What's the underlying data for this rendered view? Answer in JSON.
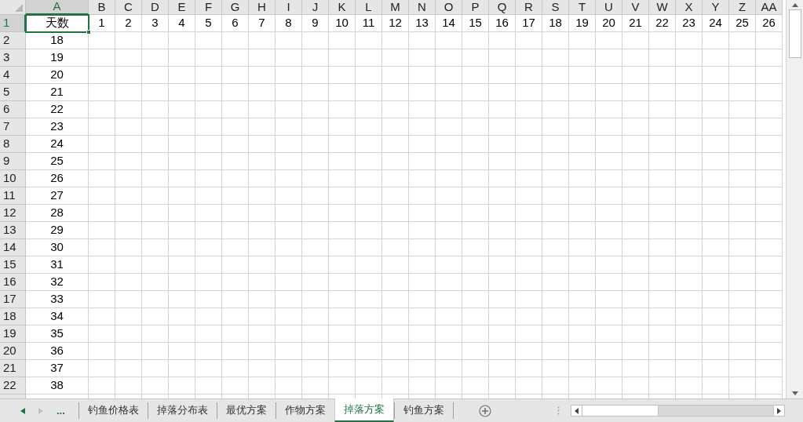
{
  "columns": [
    {
      "label": "A",
      "selected": true
    },
    {
      "label": "B",
      "selected": false
    },
    {
      "label": "C",
      "selected": false
    },
    {
      "label": "D",
      "selected": false
    },
    {
      "label": "E",
      "selected": false
    },
    {
      "label": "F",
      "selected": false
    },
    {
      "label": "G",
      "selected": false
    },
    {
      "label": "H",
      "selected": false
    },
    {
      "label": "I",
      "selected": false
    },
    {
      "label": "J",
      "selected": false
    },
    {
      "label": "K",
      "selected": false
    },
    {
      "label": "L",
      "selected": false
    },
    {
      "label": "M",
      "selected": false
    },
    {
      "label": "N",
      "selected": false
    },
    {
      "label": "O",
      "selected": false
    },
    {
      "label": "P",
      "selected": false
    },
    {
      "label": "Q",
      "selected": false
    },
    {
      "label": "R",
      "selected": false
    },
    {
      "label": "S",
      "selected": false
    },
    {
      "label": "T",
      "selected": false
    },
    {
      "label": "U",
      "selected": false
    },
    {
      "label": "V",
      "selected": false
    },
    {
      "label": "W",
      "selected": false
    },
    {
      "label": "X",
      "selected": false
    },
    {
      "label": "Y",
      "selected": false
    },
    {
      "label": "Z",
      "selected": false
    },
    {
      "label": "AA",
      "selected": false
    }
  ],
  "rows": [
    {
      "number": "1",
      "selected": true,
      "cells": [
        {
          "text": "天数",
          "selected": true
        },
        {
          "text": "1",
          "selected": false
        },
        {
          "text": "2",
          "selected": false
        },
        {
          "text": "3",
          "selected": false
        },
        {
          "text": "4",
          "selected": false
        },
        {
          "text": "5",
          "selected": false
        },
        {
          "text": "6",
          "selected": false
        },
        {
          "text": "7",
          "selected": false
        },
        {
          "text": "8",
          "selected": false
        },
        {
          "text": "9",
          "selected": false
        },
        {
          "text": "10",
          "selected": false
        },
        {
          "text": "11",
          "selected": false
        },
        {
          "text": "12",
          "selected": false
        },
        {
          "text": "13",
          "selected": false
        },
        {
          "text": "14",
          "selected": false
        },
        {
          "text": "15",
          "selected": false
        },
        {
          "text": "16",
          "selected": false
        },
        {
          "text": "17",
          "selected": false
        },
        {
          "text": "18",
          "selected": false
        },
        {
          "text": "19",
          "selected": false
        },
        {
          "text": "20",
          "selected": false
        },
        {
          "text": "21",
          "selected": false
        },
        {
          "text": "22",
          "selected": false
        },
        {
          "text": "23",
          "selected": false
        },
        {
          "text": "24",
          "selected": false
        },
        {
          "text": "25",
          "selected": false
        },
        {
          "text": "26",
          "selected": false
        }
      ]
    },
    {
      "number": "2",
      "selected": false,
      "cells": [
        {
          "text": "18",
          "selected": false
        }
      ]
    },
    {
      "number": "3",
      "selected": false,
      "cells": [
        {
          "text": "19",
          "selected": false
        }
      ]
    },
    {
      "number": "4",
      "selected": false,
      "cells": [
        {
          "text": "20",
          "selected": false
        }
      ]
    },
    {
      "number": "5",
      "selected": false,
      "cells": [
        {
          "text": "21",
          "selected": false
        }
      ]
    },
    {
      "number": "6",
      "selected": false,
      "cells": [
        {
          "text": "22",
          "selected": false
        }
      ]
    },
    {
      "number": "7",
      "selected": false,
      "cells": [
        {
          "text": "23",
          "selected": false
        }
      ]
    },
    {
      "number": "8",
      "selected": false,
      "cells": [
        {
          "text": "24",
          "selected": false
        }
      ]
    },
    {
      "number": "9",
      "selected": false,
      "cells": [
        {
          "text": "25",
          "selected": false
        }
      ]
    },
    {
      "number": "10",
      "selected": false,
      "cells": [
        {
          "text": "26",
          "selected": false
        }
      ]
    },
    {
      "number": "11",
      "selected": false,
      "cells": [
        {
          "text": "27",
          "selected": false
        }
      ]
    },
    {
      "number": "12",
      "selected": false,
      "cells": [
        {
          "text": "28",
          "selected": false
        }
      ]
    },
    {
      "number": "13",
      "selected": false,
      "cells": [
        {
          "text": "29",
          "selected": false
        }
      ]
    },
    {
      "number": "14",
      "selected": false,
      "cells": [
        {
          "text": "30",
          "selected": false
        }
      ]
    },
    {
      "number": "15",
      "selected": false,
      "cells": [
        {
          "text": "31",
          "selected": false
        }
      ]
    },
    {
      "number": "16",
      "selected": false,
      "cells": [
        {
          "text": "32",
          "selected": false
        }
      ]
    },
    {
      "number": "17",
      "selected": false,
      "cells": [
        {
          "text": "33",
          "selected": false
        }
      ]
    },
    {
      "number": "18",
      "selected": false,
      "cells": [
        {
          "text": "34",
          "selected": false
        }
      ]
    },
    {
      "number": "19",
      "selected": false,
      "cells": [
        {
          "text": "35",
          "selected": false
        }
      ]
    },
    {
      "number": "20",
      "selected": false,
      "cells": [
        {
          "text": "36",
          "selected": false
        }
      ]
    },
    {
      "number": "21",
      "selected": false,
      "cells": [
        {
          "text": "37",
          "selected": false
        }
      ]
    },
    {
      "number": "22",
      "selected": false,
      "cells": [
        {
          "text": "38",
          "selected": false
        }
      ]
    }
  ],
  "sheet_tabs": {
    "more": "...",
    "tabs": [
      {
        "label": "钓鱼价格表",
        "selected": false
      },
      {
        "label": "掉落分布表",
        "selected": false
      },
      {
        "label": "最优方案",
        "selected": false
      },
      {
        "label": "作物方案",
        "selected": false
      },
      {
        "label": "掉落方案",
        "selected": true
      },
      {
        "label": "钓鱼方案",
        "selected": false
      }
    ]
  }
}
